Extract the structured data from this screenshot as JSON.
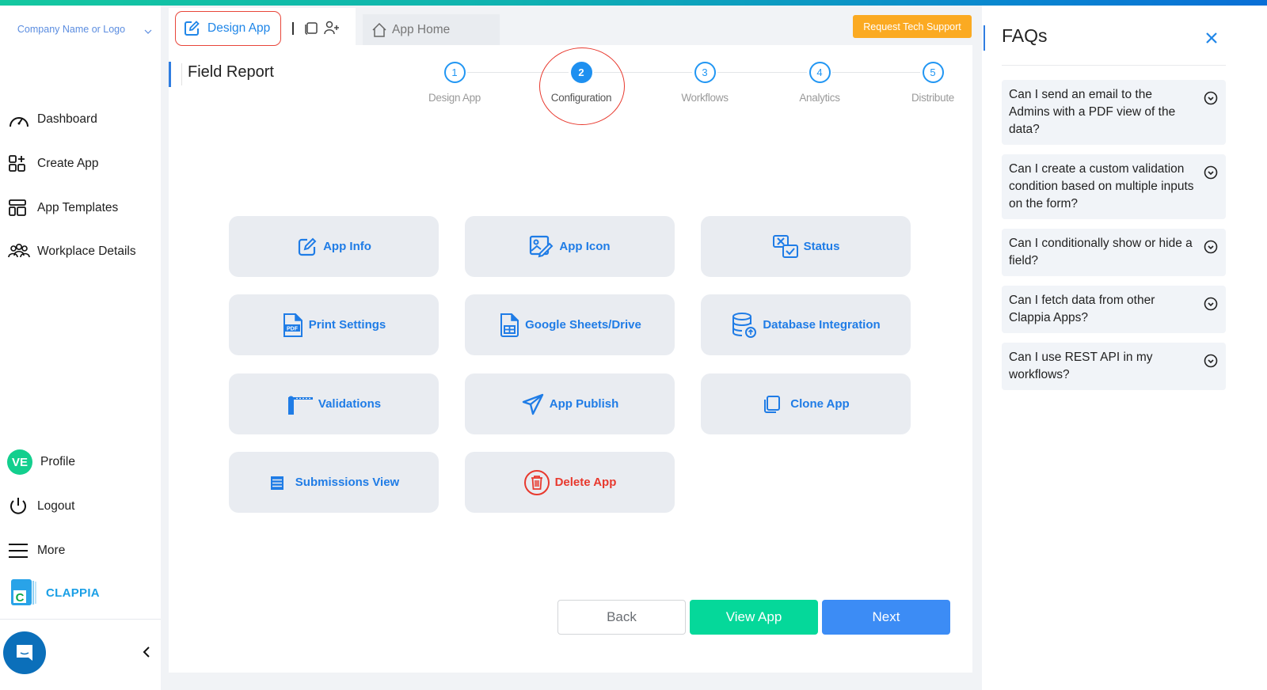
{
  "sidebar": {
    "company": "Company Name or Logo",
    "items": [
      {
        "label": "Dashboard",
        "icon": "gauge-icon"
      },
      {
        "label": "Create App",
        "icon": "create-app-icon"
      },
      {
        "label": "App Templates",
        "icon": "templates-icon"
      },
      {
        "label": "Workplace Details",
        "icon": "users-icon"
      }
    ],
    "bottom_items": [
      {
        "label": "Profile",
        "icon": "avatar",
        "initials": "VE"
      },
      {
        "label": "Logout",
        "icon": "power-icon"
      },
      {
        "label": "More",
        "icon": "menu-icon"
      }
    ],
    "brand": "CLAPPIA"
  },
  "tabs": {
    "design": "Design App",
    "home": "App Home"
  },
  "support_button": "Request Tech Support",
  "page_title": "Field Report",
  "stepper": {
    "current_step": 2,
    "steps": [
      {
        "num": "1",
        "label": "Design App"
      },
      {
        "num": "2",
        "label": "Configuration"
      },
      {
        "num": "3",
        "label": "Workflows"
      },
      {
        "num": "4",
        "label": "Analytics"
      },
      {
        "num": "5",
        "label": "Distribute"
      }
    ]
  },
  "tiles": [
    {
      "label": "App Info",
      "icon": "edit-icon"
    },
    {
      "label": "App Icon",
      "icon": "image-edit-icon"
    },
    {
      "label": "Status",
      "icon": "status-icon"
    },
    {
      "label": "Print Settings",
      "icon": "pdf-icon"
    },
    {
      "label": "Google Sheets/Drive",
      "icon": "sheet-icon"
    },
    {
      "label": "Database Integration",
      "icon": "database-icon"
    },
    {
      "label": "Validations",
      "icon": "barrier-icon"
    },
    {
      "label": "App Publish",
      "icon": "send-icon"
    },
    {
      "label": "Clone App",
      "icon": "copy-icon"
    },
    {
      "label": "Submissions View",
      "icon": "list-icon"
    },
    {
      "label": "Delete App",
      "icon": "trash-icon"
    }
  ],
  "actions": {
    "back": "Back",
    "view": "View App",
    "next": "Next"
  },
  "faq": {
    "title": "FAQs",
    "items": [
      "Can I send an email to the Admins with a PDF view of the data?",
      "Can I create a custom validation condition based on multiple inputs on the form?",
      "Can I conditionally show or hide a field?",
      "Can I fetch data from other Clappia Apps?",
      "Can I use REST API in my workflows?"
    ]
  },
  "colors": {
    "primary": "#1f7ce6",
    "danger": "#e8392e",
    "success": "#05d89a",
    "next": "#3c8cf5",
    "support": "#fbaa22"
  }
}
